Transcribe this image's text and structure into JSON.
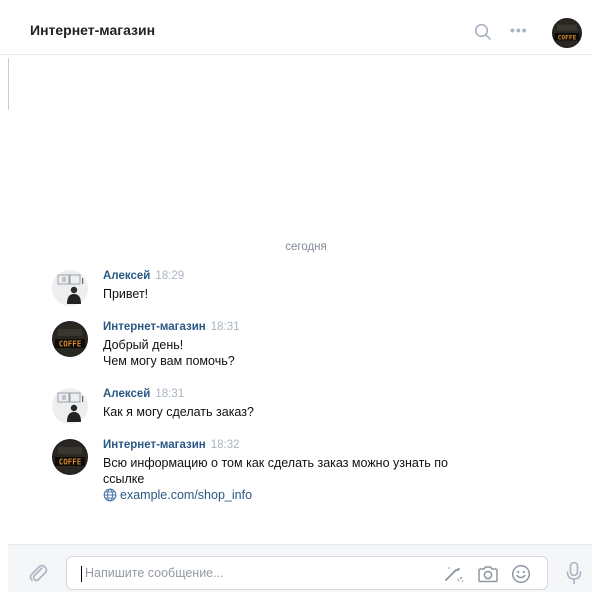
{
  "header": {
    "title": "Интернет-магазин",
    "more_label": "•••",
    "icons": {
      "search": "search-icon",
      "more": "more-dots-icon",
      "avatar": "coffee-avatar"
    }
  },
  "chat": {
    "date_separator": "сегодня",
    "messages": [
      {
        "author": "Алексей",
        "time": "18:29",
        "lines": [
          "Привет!"
        ],
        "avatar": "person-avatar"
      },
      {
        "author": "Интернет-магазин",
        "time": "18:31",
        "lines": [
          "Добрый день!",
          "Чем могу вам помочь?"
        ],
        "avatar": "coffee-avatar"
      },
      {
        "author": "Алексей",
        "time": "18:31",
        "lines": [
          "Как я могу сделать заказ?"
        ],
        "avatar": "person-avatar"
      },
      {
        "author": "Интернет-магазин",
        "time": "18:32",
        "lines": [
          "Всю информацию о том как сделать заказ можно узнать по",
          "ссылке"
        ],
        "link": "example.com/shop_info",
        "avatar": "coffee-avatar"
      }
    ]
  },
  "composer": {
    "placeholder": "Напишите сообщение...",
    "icons": [
      "paperclip-icon",
      "graffiti-icon",
      "camera-icon",
      "smile-icon",
      "microphone-icon"
    ]
  },
  "colors": {
    "author": "#2a5885",
    "time": "#aab4c2",
    "accent": "#4a76a8"
  }
}
